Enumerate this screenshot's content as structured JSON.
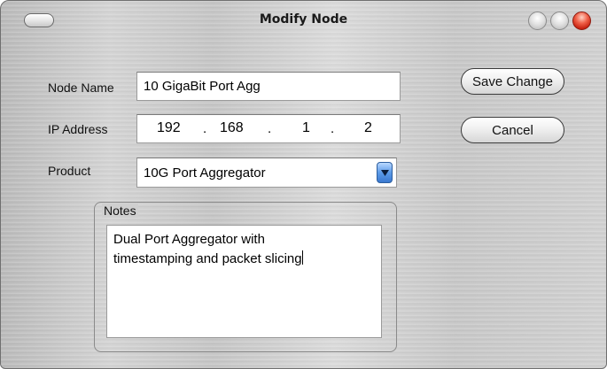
{
  "window": {
    "title": "Modify Node"
  },
  "form": {
    "node_name": {
      "label": "Node Name",
      "value": "10 GigaBit Port Agg"
    },
    "ip_address": {
      "label": "IP Address",
      "octets": [
        "192",
        "168",
        "1",
        "2"
      ],
      "separator": "."
    },
    "product": {
      "label": "Product",
      "selected": "10G Port Aggregator"
    },
    "notes": {
      "label": "Notes",
      "value": "Dual Port Aggregator with\ntimestamping and packet slicing"
    }
  },
  "buttons": {
    "save": "Save Change",
    "cancel": "Cancel"
  },
  "icons": {
    "collapse": "toolbar-pill-icon",
    "minimize": "minimize-icon",
    "zoom": "zoom-icon",
    "close": "close-icon",
    "dropdown": "chevron-down-icon"
  },
  "colors": {
    "close_button": "#e0442c",
    "dropdown_button": "#5c9be8"
  }
}
